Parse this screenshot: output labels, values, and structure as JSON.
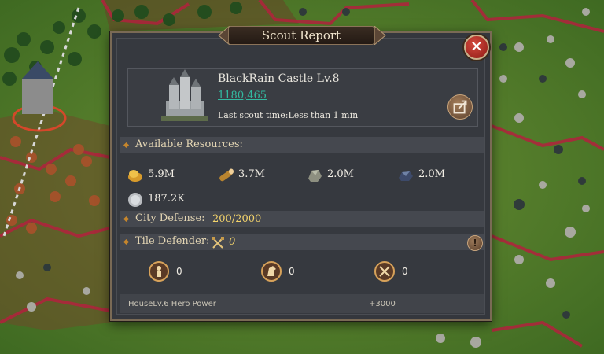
{
  "window": {
    "title": "Scout Report",
    "close_icon": "close-icon"
  },
  "castle": {
    "name": "BlackRain Castle Lv.8",
    "coords": "1180,465",
    "scout_time": "Last scout time:Less than 1 min",
    "share_icon": "share-icon"
  },
  "resources": {
    "header": "Available Resources:",
    "items": [
      {
        "icon": "food-icon",
        "value": "5.9M"
      },
      {
        "icon": "wood-icon",
        "value": "3.7M"
      },
      {
        "icon": "stone-icon",
        "value": "2.0M"
      },
      {
        "icon": "iron-icon",
        "value": "2.0M"
      },
      {
        "icon": "silver-icon",
        "value": "187.2K"
      }
    ]
  },
  "defense": {
    "label": "City Defense:",
    "value": "200/2000"
  },
  "tile_defender": {
    "label": "Tile Defender:",
    "value": "0"
  },
  "troops": [
    {
      "icon": "infantry-icon",
      "value": "0"
    },
    {
      "icon": "cavalry-icon",
      "value": "0"
    },
    {
      "icon": "archer-icon",
      "value": "0"
    }
  ],
  "footer": {
    "label": "HouseLv.6 Hero Power",
    "value": "+3000"
  },
  "colors": {
    "panel_bg": "#34373d",
    "accent_gold": "#f3d36b",
    "coords_teal": "#33b9a0",
    "close_red": "#b3271f"
  }
}
